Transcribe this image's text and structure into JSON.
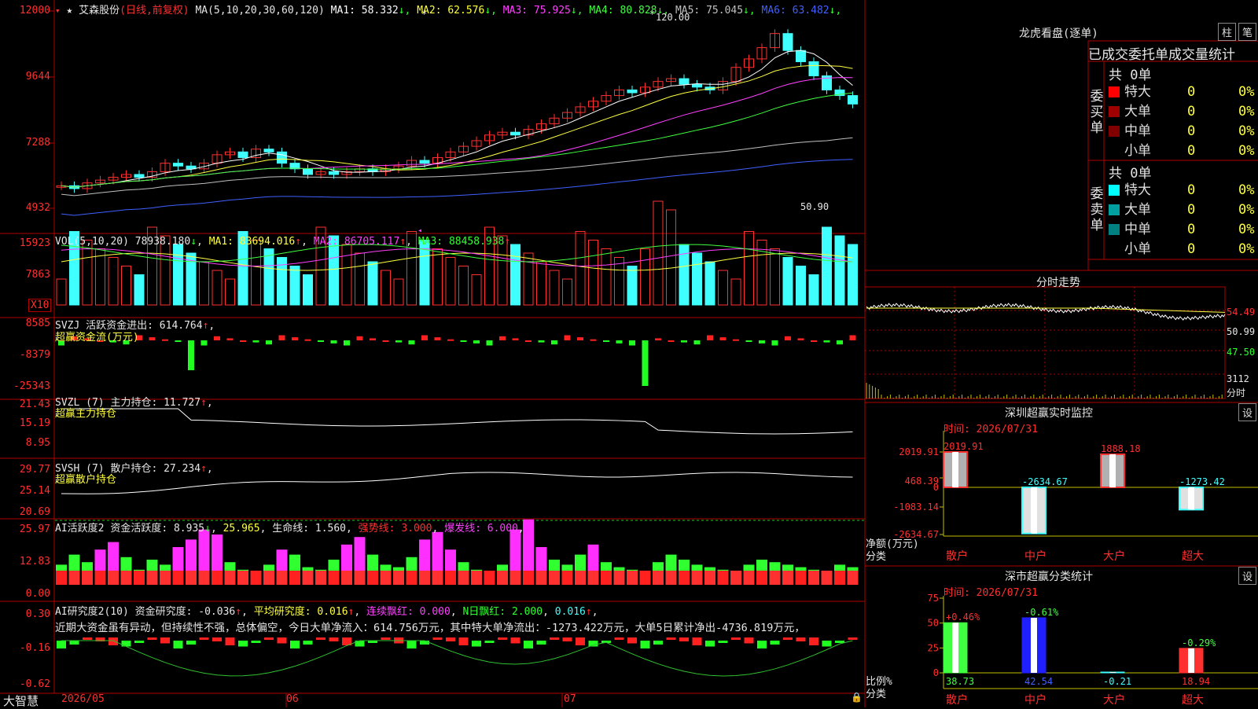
{
  "stock": {
    "name": "艾森股份",
    "mode": "(日线,前复权)",
    "ma_def": "MA(5,10,20,30,60,120)"
  },
  "ma": [
    {
      "label": "MA1:",
      "value": "58.332",
      "arrow": "↓",
      "color": "#ffffff"
    },
    {
      "label": "MA2:",
      "value": "62.576",
      "arrow": "↓",
      "color": "#ffff40"
    },
    {
      "label": "MA3:",
      "value": "75.925",
      "arrow": "↓",
      "color": "#ff40ff"
    },
    {
      "label": "MA4:",
      "value": "80.828",
      "arrow": "↓",
      "color": "#40ff40"
    },
    {
      "label": "MA5:",
      "value": "75.045",
      "arrow": "↓",
      "color": "#c0c0c0"
    },
    {
      "label": "MA6:",
      "value": "63.482",
      "arrow": "↓",
      "color": "#4060ff"
    }
  ],
  "price_axis": [
    "12000",
    "9644",
    "7288",
    "4932"
  ],
  "high_label": "120.00",
  "low_label": "50.90",
  "vol": {
    "def": "VOL(5,10,20)",
    "value": "78938.180",
    "arrow": "↓",
    "ma1": "MA1: 83694.016",
    "ma2": "MA2: 86705.117",
    "ma3": "MA3: 88458.938",
    "ma_arrow": "↑",
    "axis": [
      "15923",
      "7863"
    ],
    "unit": "X10"
  },
  "svzj": {
    "def": "SVZJ",
    "label": "活跃资金进出:",
    "value": "614.764",
    "arrow": "↑",
    "sub": "超赢资金流(万元)",
    "axis": [
      "8585",
      "-8379",
      "-25343"
    ]
  },
  "svzl": {
    "def": "SVZL (7)",
    "label": "主力持仓:",
    "value": "11.727",
    "arrow": "↑",
    "sub": "超赢主力持仓",
    "axis": [
      "21.43",
      "15.19",
      "8.95"
    ]
  },
  "svsh": {
    "def": "SVSH (7)",
    "label": "散户持仓:",
    "value": "27.234",
    "arrow": "↑",
    "sub": "超赢散户持仓",
    "axis": [
      "29.77",
      "25.14",
      "20.69"
    ]
  },
  "ai_act": {
    "def": "AI活跃度2",
    "label": "资金活跃度:",
    "value": "8.935",
    "arrow": "↓",
    "v2": "25.965",
    "life": "生命线: 1.560",
    "strong": "强势线: 3.000",
    "burst": "爆发线: 6.000",
    "axis": [
      "25.97",
      "12.83",
      "0.00"
    ]
  },
  "ai_res": {
    "def": "AI研究度2(10)",
    "label": "资金研究度:",
    "value": "-0.036",
    "avg": "平均研究度: 0.016",
    "lx": "连续飘红: 0.000",
    "nd": "N日飘红: 2.000",
    "v5": "0.016",
    "arrow": "↑",
    "axis": [
      "0.30",
      "-0.16",
      "-0.62"
    ],
    "comment": "近期大资金虽有异动，但持续性不强，总体偏空，今日大单净流入：614.756万元，其中特大单净流出：-1273.422万元，大单5日累计净出-4736.819万元，"
  },
  "time_axis": [
    "2026/05",
    "06",
    "07"
  ],
  "brand": "大智慧",
  "lhk": {
    "title": "龙虎看盘(逐单)",
    "btn_bar": "柱",
    "btn_pen": "笔",
    "tabs": [
      "已成交",
      "委托单",
      "成交量统计"
    ],
    "buy": {
      "side": "委买单",
      "total": "共 0单",
      "rows": [
        {
          "name": "特大",
          "color": "#ff0000",
          "n": "0",
          "p": "0%"
        },
        {
          "name": "大单",
          "color": "#a00000",
          "n": "0",
          "p": "0%"
        },
        {
          "name": "中单",
          "color": "#800000",
          "n": "0",
          "p": "0%"
        },
        {
          "name": "小单",
          "color": "#000000",
          "n": "0",
          "p": "0%"
        }
      ]
    },
    "sell": {
      "side": "委卖单",
      "total": "共 0单",
      "rows": [
        {
          "name": "特大",
          "color": "#00ffff",
          "n": "0",
          "p": "0%"
        },
        {
          "name": "大单",
          "color": "#00a0a0",
          "n": "0",
          "p": "0%"
        },
        {
          "name": "中单",
          "color": "#008080",
          "n": "0",
          "p": "0%"
        },
        {
          "name": "小单",
          "color": "#000000",
          "n": "0",
          "p": "0%"
        }
      ]
    }
  },
  "fenshi": {
    "title": "分时走势",
    "axis": [
      "54.49",
      "50.99",
      "47.50"
    ],
    "vol_top": "3112",
    "vol_label": "分时"
  },
  "monitor": {
    "title": "深圳超赢实时监控",
    "set": "设",
    "time": "时间: 2026/07/31",
    "axis": [
      "2019.91",
      "468.39",
      "0",
      "-1083.14",
      "-2634.67"
    ],
    "ylabel": "净额(万元)",
    "xlabel": "分类",
    "bars": [
      {
        "cat": "散户",
        "value": 2019.91,
        "label": "2019.91",
        "color": "#ff3030",
        "fill": "#b0b0b0"
      },
      {
        "cat": "中户",
        "value": -2634.67,
        "label": "-2634.67",
        "color": "#40ffff",
        "fill": "#e0e0e0"
      },
      {
        "cat": "大户",
        "value": 1888.18,
        "label": "1888.18",
        "color": "#ff3030",
        "fill": "#b0b0b0"
      },
      {
        "cat": "超大",
        "value": -1273.42,
        "label": "-1273.42",
        "color": "#40ffff",
        "fill": "#e0e0e0"
      }
    ]
  },
  "classify": {
    "title": "深市超赢分类统计",
    "set": "设",
    "time": "时间: 2026/07/31",
    "axis": [
      "75",
      "50",
      "25",
      "0"
    ],
    "ylabel": "比例%",
    "xlabel": "分类",
    "bars": [
      {
        "cat": "散户",
        "value": 38.73,
        "label": "38.73",
        "chg": "+0.46%",
        "chg_color": "#ff3030",
        "fill": "#40ff40"
      },
      {
        "cat": "中户",
        "value": 42.54,
        "label": "42.54",
        "chg": "-0.61%",
        "chg_color": "#40ff40",
        "fill": "#2020ff"
      },
      {
        "cat": "大户",
        "value": -0.21,
        "label": "-0.21",
        "chg": "",
        "chg_color": "#40ffff",
        "fill": "#40ffff"
      },
      {
        "cat": "超大",
        "value": 18.94,
        "label": "18.94",
        "chg": "-0.29%",
        "chg_color": "#40ff40",
        "fill": "#ff3030"
      }
    ]
  }
}
